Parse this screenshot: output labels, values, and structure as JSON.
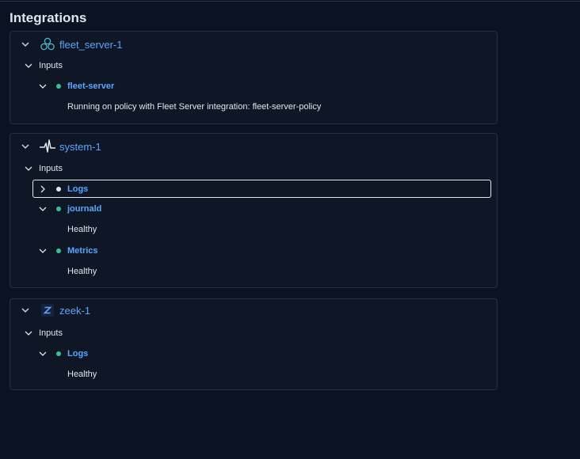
{
  "page": {
    "title": "Integrations"
  },
  "colors": {
    "healthy": "#36c28f",
    "unknown": "#e6e8ee",
    "link": "#5aa6ff"
  },
  "integrations": [
    {
      "name": "fleet_server-1",
      "icon": "fleet-server-icon",
      "inputs_label": "Inputs",
      "inputs": [
        {
          "name": "fleet-server",
          "status": "healthy",
          "expanded": true,
          "message": "Running on policy with Fleet Server integration: fleet-server-policy"
        }
      ]
    },
    {
      "name": "system-1",
      "icon": "system-pulse-icon",
      "inputs_label": "Inputs",
      "inputs": [
        {
          "name": "Logs",
          "status": "unknown",
          "expanded": false,
          "focused": true
        },
        {
          "name": "journald",
          "status": "healthy",
          "expanded": true,
          "message": "Healthy"
        },
        {
          "name": "Metrics",
          "status": "healthy",
          "expanded": true,
          "message": "Healthy"
        }
      ]
    },
    {
      "name": "zeek-1",
      "icon": "zeek-icon",
      "inputs_label": "Inputs",
      "inputs": [
        {
          "name": "Logs",
          "status": "healthy",
          "expanded": true,
          "message": "Healthy"
        }
      ]
    }
  ]
}
